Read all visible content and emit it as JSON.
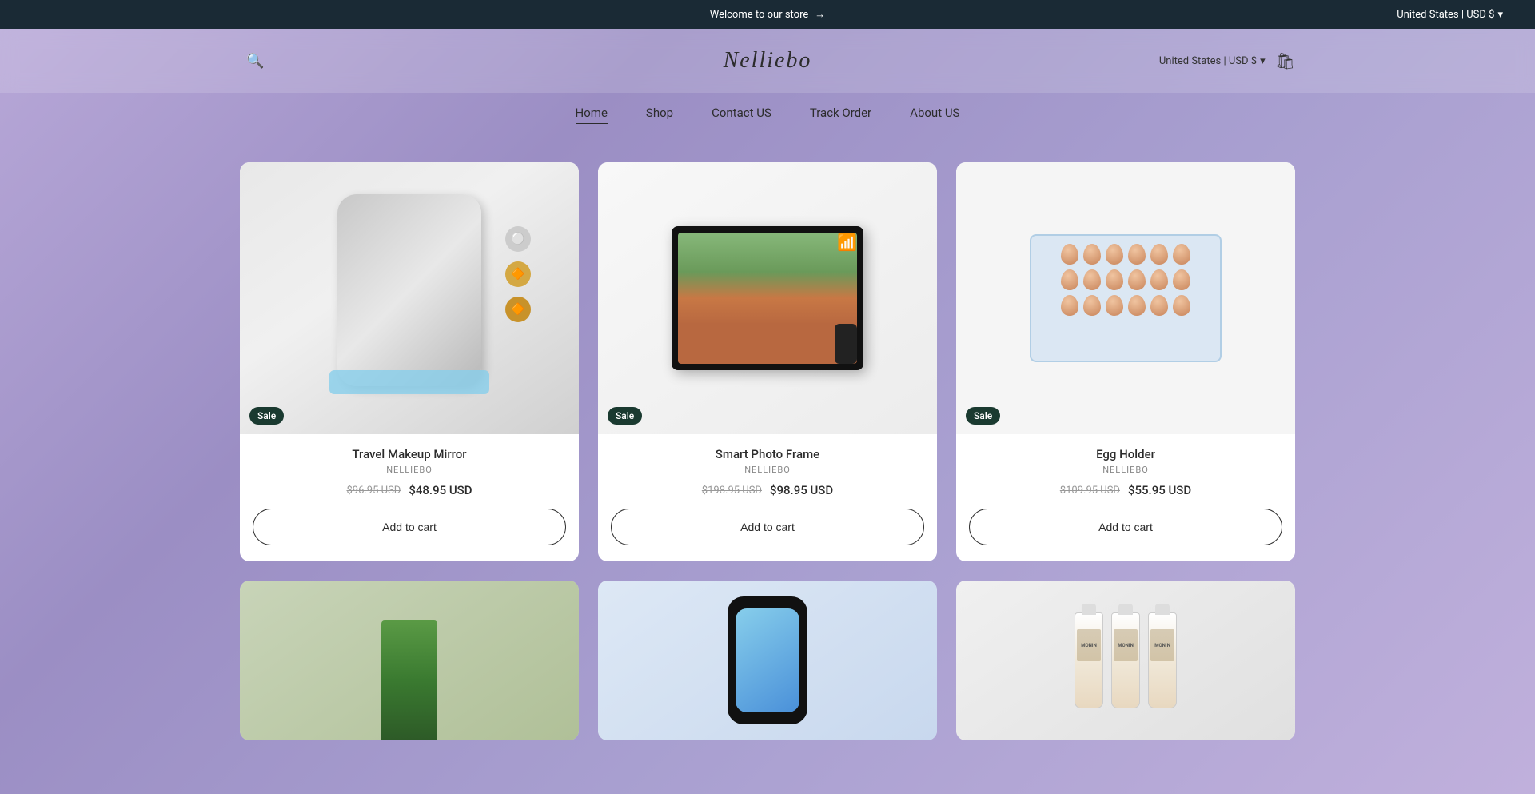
{
  "announcement": {
    "welcome_text": "Welcome to our store",
    "arrow": "→",
    "country": "United States | USD $",
    "chevron": "▾"
  },
  "header": {
    "logo": "Nelliebo",
    "country_label": "United States | USD $",
    "chevron": "▾"
  },
  "nav": {
    "items": [
      {
        "label": "Home",
        "active": true
      },
      {
        "label": "Shop",
        "active": false
      },
      {
        "label": "Contact US",
        "active": false
      },
      {
        "label": "Track Order",
        "active": false
      },
      {
        "label": "About US",
        "active": false
      }
    ]
  },
  "products": [
    {
      "name": "Travel Makeup Mirror",
      "vendor": "NELLIEBO",
      "price_original": "$96.95 USD",
      "price_sale": "$48.95 USD",
      "sale_badge": "Sale",
      "add_to_cart": "Add to cart",
      "type": "mirror"
    },
    {
      "name": "Smart Photo Frame",
      "vendor": "NELLIEBO",
      "price_original": "$198.95 USD",
      "price_sale": "$98.95 USD",
      "sale_badge": "Sale",
      "add_to_cart": "Add to cart",
      "type": "frame"
    },
    {
      "name": "Egg Holder",
      "vendor": "NELLIEBO",
      "price_original": "$109.95 USD",
      "price_sale": "$55.95 USD",
      "sale_badge": "Sale",
      "add_to_cart": "Add to cart",
      "type": "egg"
    }
  ],
  "partial_products": [
    {
      "type": "plant"
    },
    {
      "type": "phone"
    },
    {
      "type": "bottles"
    }
  ]
}
